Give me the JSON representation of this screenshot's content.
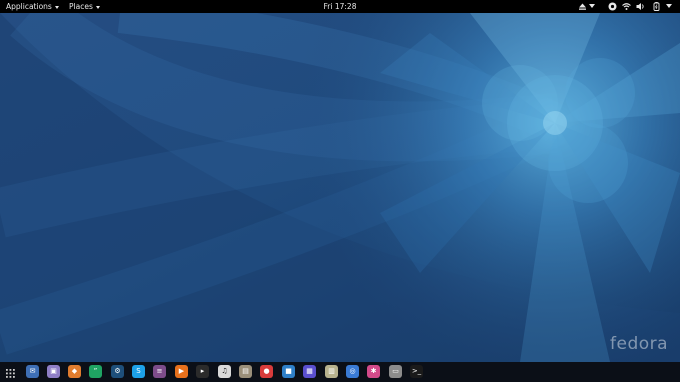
{
  "top_bar": {
    "applications_label": "Applications",
    "places_label": "Places",
    "clock": "Fri 17:28",
    "tray": [
      "eject-icon",
      "accessibility-icon",
      "wifi-icon",
      "volume-icon",
      "battery-icon",
      "power-menu-icon"
    ]
  },
  "wallpaper": {
    "brand": "fedora"
  },
  "dock": {
    "items": [
      {
        "name": "show-apps-icon",
        "color": "#0b0f17"
      },
      {
        "name": "mail-icon",
        "color": "#3e6fb5"
      },
      {
        "name": "photos-icon",
        "color": "#8f7fc6"
      },
      {
        "name": "software-icon",
        "color": "#e07c2e"
      },
      {
        "name": "hangouts-icon",
        "color": "#1fa463"
      },
      {
        "name": "steam-icon",
        "color": "#1e4f7a"
      },
      {
        "name": "skype-icon",
        "color": "#1da1e8"
      },
      {
        "name": "database-icon",
        "color": "#7d4c8a"
      },
      {
        "name": "media-player-icon",
        "color": "#e8711c"
      },
      {
        "name": "terminal-play-icon",
        "color": "#2b2b2b"
      },
      {
        "name": "music-icon",
        "color": "#d9d9d9"
      },
      {
        "name": "archive-icon",
        "color": "#9a8f7a"
      },
      {
        "name": "maps-icon",
        "color": "#d83b3b"
      },
      {
        "name": "files-icon",
        "color": "#2e7fc8"
      },
      {
        "name": "calendar-icon",
        "color": "#5a4fcf"
      },
      {
        "name": "notes-icon",
        "color": "#b7b28e"
      },
      {
        "name": "web-browser-icon",
        "color": "#3a7bd5"
      },
      {
        "name": "settings-icon",
        "color": "#d44a8a"
      },
      {
        "name": "document-icon",
        "color": "#8c8c8c"
      },
      {
        "name": "console-icon",
        "color": "#1a1a1a"
      }
    ]
  }
}
